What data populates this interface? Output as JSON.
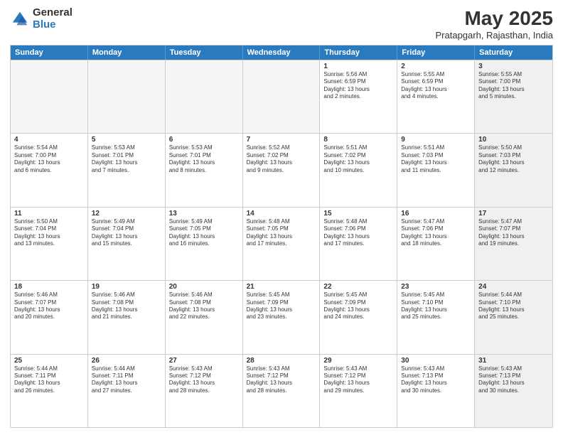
{
  "logo": {
    "general": "General",
    "blue": "Blue"
  },
  "header": {
    "title": "May 2025",
    "subtitle": "Pratapgarh, Rajasthan, India"
  },
  "days": [
    "Sunday",
    "Monday",
    "Tuesday",
    "Wednesday",
    "Thursday",
    "Friday",
    "Saturday"
  ],
  "rows": [
    [
      {
        "day": "",
        "text": "",
        "empty": true
      },
      {
        "day": "",
        "text": "",
        "empty": true
      },
      {
        "day": "",
        "text": "",
        "empty": true
      },
      {
        "day": "",
        "text": "",
        "empty": true
      },
      {
        "day": "1",
        "text": "Sunrise: 5:56 AM\nSunset: 6:59 PM\nDaylight: 13 hours\nand 2 minutes.",
        "empty": false
      },
      {
        "day": "2",
        "text": "Sunrise: 5:55 AM\nSunset: 6:59 PM\nDaylight: 13 hours\nand 4 minutes.",
        "empty": false
      },
      {
        "day": "3",
        "text": "Sunrise: 5:55 AM\nSunset: 7:00 PM\nDaylight: 13 hours\nand 5 minutes.",
        "empty": false,
        "shaded": true
      }
    ],
    [
      {
        "day": "4",
        "text": "Sunrise: 5:54 AM\nSunset: 7:00 PM\nDaylight: 13 hours\nand 6 minutes.",
        "empty": false
      },
      {
        "day": "5",
        "text": "Sunrise: 5:53 AM\nSunset: 7:01 PM\nDaylight: 13 hours\nand 7 minutes.",
        "empty": false
      },
      {
        "day": "6",
        "text": "Sunrise: 5:53 AM\nSunset: 7:01 PM\nDaylight: 13 hours\nand 8 minutes.",
        "empty": false
      },
      {
        "day": "7",
        "text": "Sunrise: 5:52 AM\nSunset: 7:02 PM\nDaylight: 13 hours\nand 9 minutes.",
        "empty": false
      },
      {
        "day": "8",
        "text": "Sunrise: 5:51 AM\nSunset: 7:02 PM\nDaylight: 13 hours\nand 10 minutes.",
        "empty": false
      },
      {
        "day": "9",
        "text": "Sunrise: 5:51 AM\nSunset: 7:03 PM\nDaylight: 13 hours\nand 11 minutes.",
        "empty": false
      },
      {
        "day": "10",
        "text": "Sunrise: 5:50 AM\nSunset: 7:03 PM\nDaylight: 13 hours\nand 12 minutes.",
        "empty": false,
        "shaded": true
      }
    ],
    [
      {
        "day": "11",
        "text": "Sunrise: 5:50 AM\nSunset: 7:04 PM\nDaylight: 13 hours\nand 13 minutes.",
        "empty": false
      },
      {
        "day": "12",
        "text": "Sunrise: 5:49 AM\nSunset: 7:04 PM\nDaylight: 13 hours\nand 15 minutes.",
        "empty": false
      },
      {
        "day": "13",
        "text": "Sunrise: 5:49 AM\nSunset: 7:05 PM\nDaylight: 13 hours\nand 16 minutes.",
        "empty": false
      },
      {
        "day": "14",
        "text": "Sunrise: 5:48 AM\nSunset: 7:05 PM\nDaylight: 13 hours\nand 17 minutes.",
        "empty": false
      },
      {
        "day": "15",
        "text": "Sunrise: 5:48 AM\nSunset: 7:06 PM\nDaylight: 13 hours\nand 17 minutes.",
        "empty": false
      },
      {
        "day": "16",
        "text": "Sunrise: 5:47 AM\nSunset: 7:06 PM\nDaylight: 13 hours\nand 18 minutes.",
        "empty": false
      },
      {
        "day": "17",
        "text": "Sunrise: 5:47 AM\nSunset: 7:07 PM\nDaylight: 13 hours\nand 19 minutes.",
        "empty": false,
        "shaded": true
      }
    ],
    [
      {
        "day": "18",
        "text": "Sunrise: 5:46 AM\nSunset: 7:07 PM\nDaylight: 13 hours\nand 20 minutes.",
        "empty": false
      },
      {
        "day": "19",
        "text": "Sunrise: 5:46 AM\nSunset: 7:08 PM\nDaylight: 13 hours\nand 21 minutes.",
        "empty": false
      },
      {
        "day": "20",
        "text": "Sunrise: 5:46 AM\nSunset: 7:08 PM\nDaylight: 13 hours\nand 22 minutes.",
        "empty": false
      },
      {
        "day": "21",
        "text": "Sunrise: 5:45 AM\nSunset: 7:09 PM\nDaylight: 13 hours\nand 23 minutes.",
        "empty": false
      },
      {
        "day": "22",
        "text": "Sunrise: 5:45 AM\nSunset: 7:09 PM\nDaylight: 13 hours\nand 24 minutes.",
        "empty": false
      },
      {
        "day": "23",
        "text": "Sunrise: 5:45 AM\nSunset: 7:10 PM\nDaylight: 13 hours\nand 25 minutes.",
        "empty": false
      },
      {
        "day": "24",
        "text": "Sunrise: 5:44 AM\nSunset: 7:10 PM\nDaylight: 13 hours\nand 25 minutes.",
        "empty": false,
        "shaded": true
      }
    ],
    [
      {
        "day": "25",
        "text": "Sunrise: 5:44 AM\nSunset: 7:11 PM\nDaylight: 13 hours\nand 26 minutes.",
        "empty": false
      },
      {
        "day": "26",
        "text": "Sunrise: 5:44 AM\nSunset: 7:11 PM\nDaylight: 13 hours\nand 27 minutes.",
        "empty": false
      },
      {
        "day": "27",
        "text": "Sunrise: 5:43 AM\nSunset: 7:12 PM\nDaylight: 13 hours\nand 28 minutes.",
        "empty": false
      },
      {
        "day": "28",
        "text": "Sunrise: 5:43 AM\nSunset: 7:12 PM\nDaylight: 13 hours\nand 28 minutes.",
        "empty": false
      },
      {
        "day": "29",
        "text": "Sunrise: 5:43 AM\nSunset: 7:12 PM\nDaylight: 13 hours\nand 29 minutes.",
        "empty": false
      },
      {
        "day": "30",
        "text": "Sunrise: 5:43 AM\nSunset: 7:13 PM\nDaylight: 13 hours\nand 30 minutes.",
        "empty": false
      },
      {
        "day": "31",
        "text": "Sunrise: 5:43 AM\nSunset: 7:13 PM\nDaylight: 13 hours\nand 30 minutes.",
        "empty": false,
        "shaded": true
      }
    ]
  ]
}
